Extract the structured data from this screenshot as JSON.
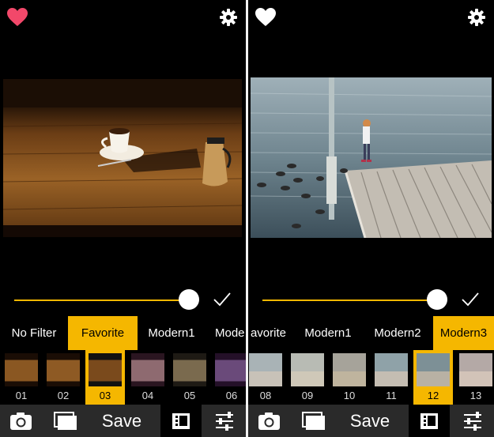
{
  "colors": {
    "accent": "#f5b700",
    "heart": "#f2486a",
    "toolbar": "#2a2a2a",
    "track": "#f5b700"
  },
  "left": {
    "filters": [
      "No Filter",
      "Favorite",
      "Modern1",
      "Mode"
    ],
    "selected_filter": "Favorite",
    "thumb_numbers": [
      "01",
      "02",
      "03",
      "04",
      "05",
      "06"
    ],
    "selected_thumb": "03",
    "toolbar": {
      "save_label": "Save"
    }
  },
  "right": {
    "filters": [
      "avorite",
      "Modern1",
      "Modern2",
      "Modern3"
    ],
    "selected_filter": "Modern3",
    "thumb_numbers": [
      "08",
      "09",
      "10",
      "11",
      "12",
      "13"
    ],
    "selected_thumb": "12",
    "toolbar": {
      "save_label": "Save"
    }
  },
  "icons": {
    "favorite": "heart-icon",
    "settings": "gear-icon",
    "confirm": "checkmark-icon",
    "camera": "camera-icon",
    "library": "photo-stack-icon",
    "filters": "film-strip-icon",
    "adjust": "sliders-icon"
  }
}
